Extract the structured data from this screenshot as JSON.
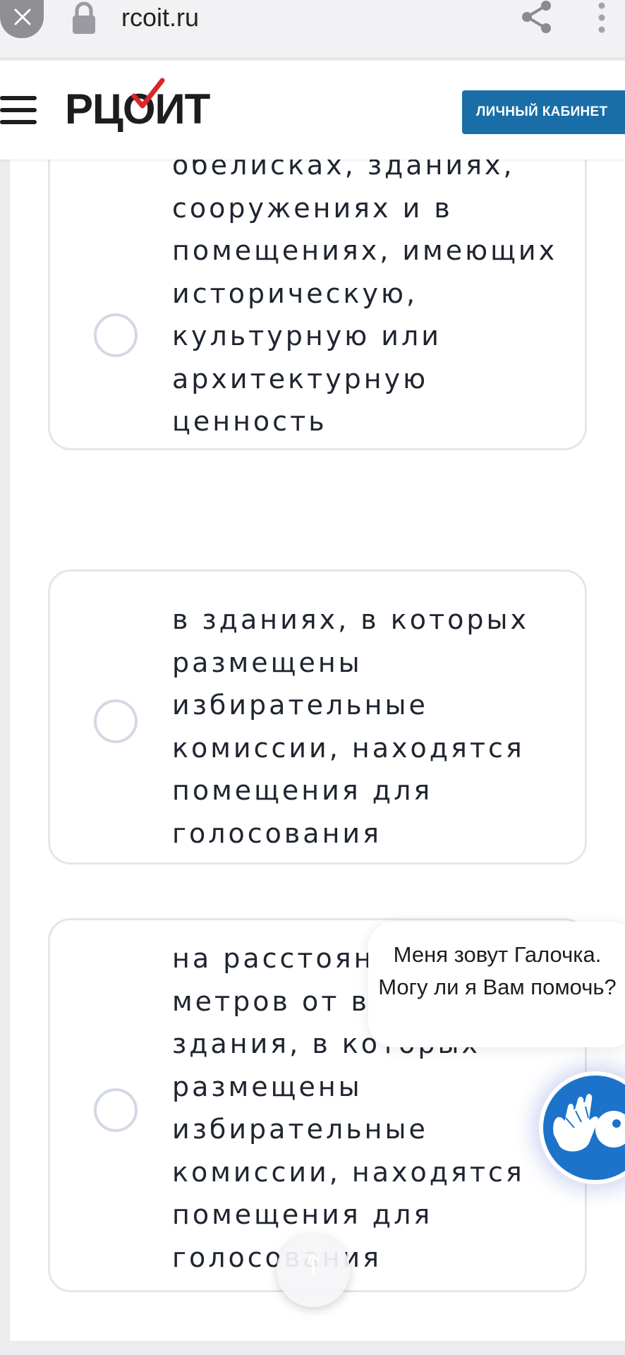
{
  "browser": {
    "url": "rcoit.ru",
    "icons": [
      "close-icon",
      "lock-icon",
      "share-icon",
      "kebab-menu-icon"
    ]
  },
  "header": {
    "logo_text": "РЦОИТ",
    "cabinet_button": "ЛИЧНЫЙ КАБИНЕТ",
    "icons": [
      "hamburger-menu-icon"
    ],
    "colors": {
      "button": "#1a6ea8",
      "logo_check": "#d9262c"
    }
  },
  "options": [
    {
      "text": "обелисках, зданиях, сооружениях и в помещениях, имеющих историческую, культурную или архитектурную ценность",
      "selected": false
    },
    {
      "text": "в зданиях, в которых размещены избирательные комиссии, находятся помещения для голосования",
      "selected": false
    },
    {
      "text": "на расстоянии менее 50 метров от входа в здания, в которых размещены избирательные комиссии, находятся помещения для голосования",
      "selected": false
    }
  ],
  "chat": {
    "message": "Меня зовут Галочка. Могу ли я Вам помочь?",
    "icons": [
      "assistant-avatar-icon"
    ]
  },
  "scroll_top": {
    "icon": "arrow-up-icon",
    "glyph": "↑"
  }
}
